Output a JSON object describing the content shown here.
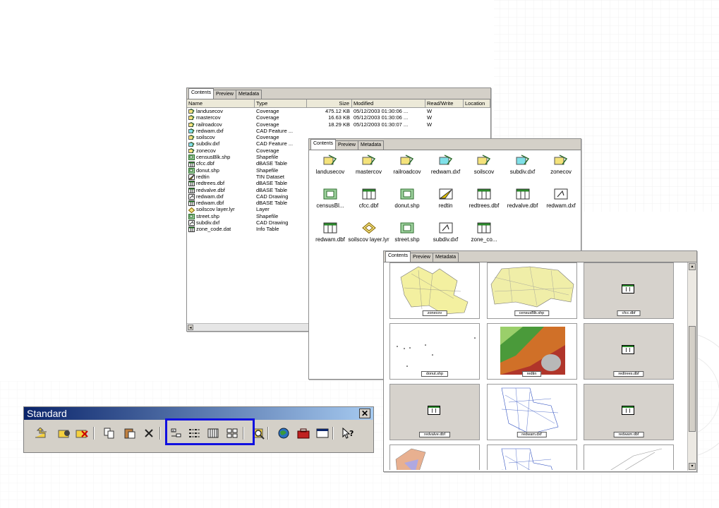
{
  "window1": {
    "tabs": [
      "Contents",
      "Preview",
      "Metadata"
    ],
    "columns": [
      "Name",
      "Type",
      "Size",
      "Modified",
      "Read/Write",
      "Location"
    ],
    "rows": [
      {
        "name": "landusecov",
        "type": "Coverage",
        "size": "475.12 KB",
        "modified": "05/12/2003 01:30:06 ...",
        "rw": "W",
        "icon": "coverage-icon"
      },
      {
        "name": "mastercov",
        "type": "Coverage",
        "size": "16.63 KB",
        "modified": "05/12/2003 01:30:06 ...",
        "rw": "W",
        "icon": "coverage-icon"
      },
      {
        "name": "railroadcov",
        "type": "Coverage",
        "size": "18.29 KB",
        "modified": "05/12/2003 01:30:07 ...",
        "rw": "W",
        "icon": "coverage-icon"
      },
      {
        "name": "redwam.dxf",
        "type": "CAD Feature ...",
        "size": "",
        "modified": "",
        "rw": "",
        "icon": "cad-feature-icon"
      },
      {
        "name": "soilscov",
        "type": "Coverage",
        "size": "",
        "modified": "",
        "rw": "",
        "icon": "coverage-icon"
      },
      {
        "name": "subdiv.dxf",
        "type": "CAD Feature ...",
        "size": "",
        "modified": "",
        "rw": "",
        "icon": "cad-feature-icon"
      },
      {
        "name": "zonecov",
        "type": "Coverage",
        "size": "",
        "modified": "",
        "rw": "",
        "icon": "coverage-icon"
      },
      {
        "name": "censusBlk.shp",
        "type": "Shapefile",
        "size": "",
        "modified": "",
        "rw": "",
        "icon": "shapefile-icon"
      },
      {
        "name": "cfcc.dbf",
        "type": "dBASE Table",
        "size": "",
        "modified": "",
        "rw": "",
        "icon": "table-icon"
      },
      {
        "name": "donut.shp",
        "type": "Shapefile",
        "size": "",
        "modified": "",
        "rw": "",
        "icon": "shapefile-icon"
      },
      {
        "name": "redtin",
        "type": "TIN Dataset",
        "size": "",
        "modified": "",
        "rw": "",
        "icon": "tin-icon"
      },
      {
        "name": "redtrees.dbf",
        "type": "dBASE Table",
        "size": "",
        "modified": "",
        "rw": "",
        "icon": "table-icon"
      },
      {
        "name": "redvalve.dbf",
        "type": "dBASE Table",
        "size": "",
        "modified": "",
        "rw": "",
        "icon": "table-icon"
      },
      {
        "name": "redwam.dxf",
        "type": "CAD Drawing",
        "size": "",
        "modified": "",
        "rw": "",
        "icon": "cad-drawing-icon"
      },
      {
        "name": "redwam.dbf",
        "type": "dBASE Table",
        "size": "",
        "modified": "",
        "rw": "",
        "icon": "table-icon"
      },
      {
        "name": "soilscov layer.lyr",
        "type": "Layer",
        "size": "",
        "modified": "",
        "rw": "",
        "icon": "layer-icon"
      },
      {
        "name": "street.shp",
        "type": "Shapefile",
        "size": "",
        "modified": "",
        "rw": "",
        "icon": "shapefile-icon"
      },
      {
        "name": "subdiv.dxf",
        "type": "CAD Drawing",
        "size": "",
        "modified": "",
        "rw": "",
        "icon": "cad-drawing-icon"
      },
      {
        "name": "zone_code.dat",
        "type": "Info Table",
        "size": "",
        "modified": "",
        "rw": "",
        "icon": "table-icon"
      }
    ]
  },
  "window2": {
    "tabs": [
      "Contents",
      "Preview",
      "Metadata"
    ],
    "items": [
      {
        "label": "landusecov",
        "icon": "coverage-icon"
      },
      {
        "label": "mastercov",
        "icon": "coverage-icon"
      },
      {
        "label": "railroadcov",
        "icon": "coverage-icon"
      },
      {
        "label": "redwam.dxf",
        "icon": "cad-feature-icon"
      },
      {
        "label": "soilscov",
        "icon": "coverage-icon"
      },
      {
        "label": "subdiv.dxf",
        "icon": "cad-feature-icon"
      },
      {
        "label": "zonecov",
        "icon": "coverage-icon"
      },
      {
        "label": "censusBl...",
        "icon": "shapefile-icon"
      },
      {
        "label": "cfcc.dbf",
        "icon": "table-icon"
      },
      {
        "label": "donut.shp",
        "icon": "shapefile-icon"
      },
      {
        "label": "redtin",
        "icon": "tin-icon"
      },
      {
        "label": "redtrees.dbf",
        "icon": "table-icon"
      },
      {
        "label": "redvalve.dbf",
        "icon": "table-icon"
      },
      {
        "label": "redwam.dxf",
        "icon": "cad-drawing-icon"
      },
      {
        "label": "redwam.dbf",
        "icon": "table-icon"
      },
      {
        "label": "soilscov layer.lyr",
        "icon": "layer-icon"
      },
      {
        "label": "street.shp",
        "icon": "shapefile-icon"
      },
      {
        "label": "subdiv.dxf",
        "icon": "cad-drawing-icon"
      },
      {
        "label": "zone_co...",
        "icon": "table-icon"
      }
    ]
  },
  "window3": {
    "tabs": [
      "Contents",
      "Preview",
      "Metadata"
    ],
    "thumbs": [
      {
        "label": "zonecov",
        "kind": "map-yellow"
      },
      {
        "label": "censusBlk.shp",
        "kind": "map-census"
      },
      {
        "label": "cfcc.dbf",
        "kind": "table"
      },
      {
        "label": "donut.shp",
        "kind": "dots"
      },
      {
        "label": "redtin",
        "kind": "tin"
      },
      {
        "label": "redtrees.dbf",
        "kind": "table"
      },
      {
        "label": "redvalve.dbf",
        "kind": "table"
      },
      {
        "label": "redwam.dxf",
        "kind": "cad"
      },
      {
        "label": "redwam.dbf",
        "kind": "table"
      },
      {
        "label": "",
        "kind": "map-color"
      },
      {
        "label": "",
        "kind": "cad"
      },
      {
        "label": "",
        "kind": "lines"
      }
    ]
  },
  "toolbar": {
    "title": "Standard",
    "close": "✕",
    "buttons": [
      "up-one-level-icon",
      "connect-folder-icon",
      "disconnect-folder-icon",
      "copy-icon",
      "paste-icon",
      "delete-icon",
      "large-icons-icon",
      "list-icon",
      "details-icon",
      "thumbnails-icon",
      "search-icon",
      "launch-arcmap-icon",
      "arctoolbox-icon",
      "command-line-icon",
      "whats-this-icon"
    ]
  },
  "colors": {
    "highlight": "#1010e0",
    "titlebar": "#0a246a",
    "face": "#d4d0c8"
  }
}
